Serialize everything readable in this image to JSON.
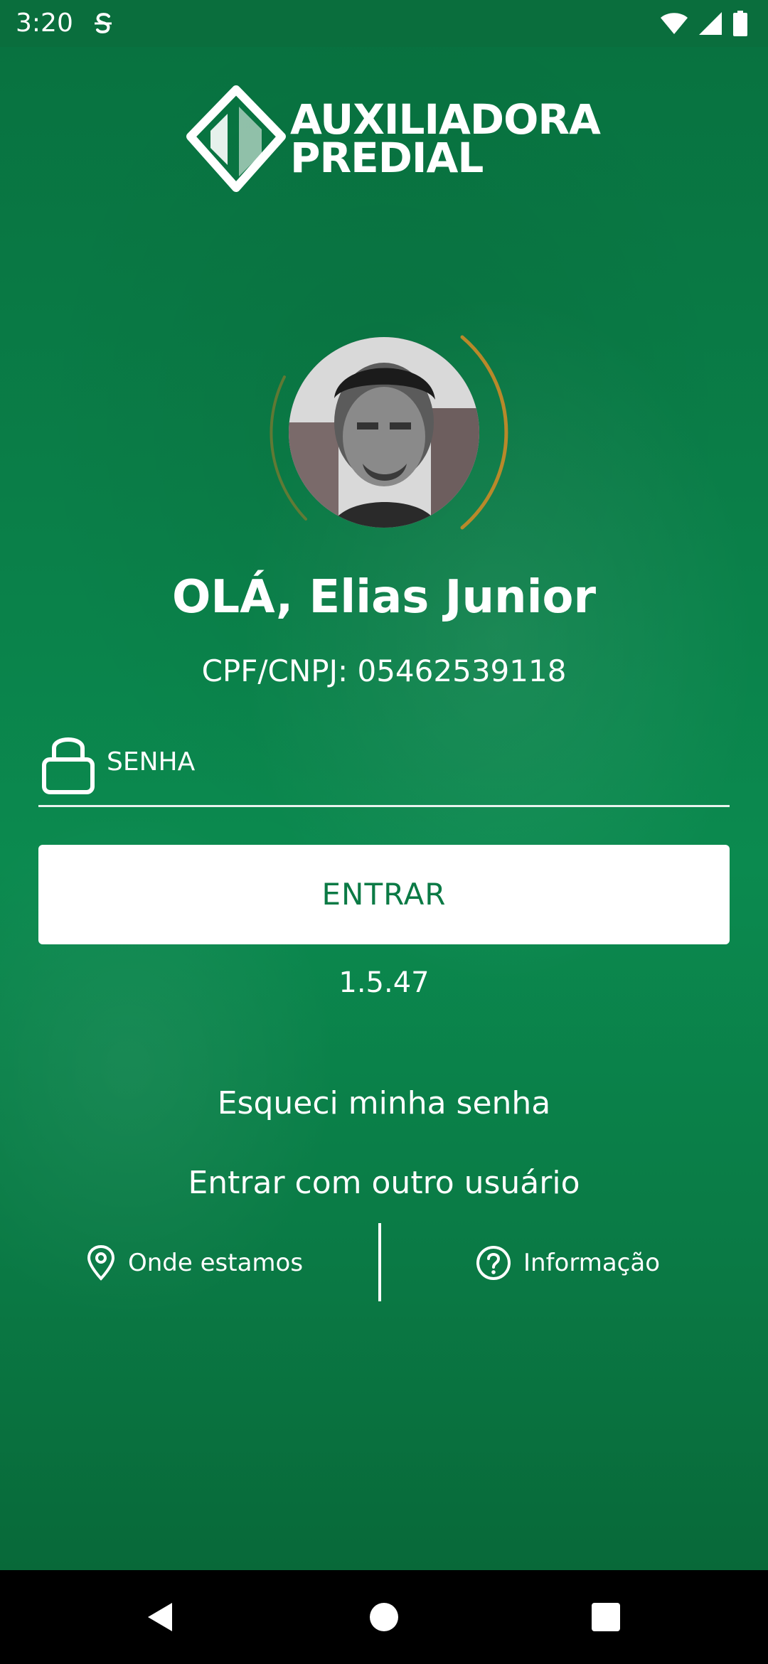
{
  "status_bar": {
    "time": "3:20"
  },
  "brand": {
    "line1": "AUXILIADORA",
    "line2": "PREDIAL"
  },
  "profile": {
    "greeting": "OLÁ, Elias Junior",
    "cpf": "CPF/CNPJ: 05462539118"
  },
  "login": {
    "password_placeholder": "SENHA",
    "password_value": "",
    "enter_label": "ENTRAR",
    "version": "1.5.47"
  },
  "links": {
    "forgot_password": "Esqueci minha senha",
    "other_user": "Entrar com outro usuário"
  },
  "footer": {
    "where": "Onde estamos",
    "info": "Informação"
  },
  "colors": {
    "brand_green": "#0b7a45",
    "status_bar": "#0a6e3d",
    "ring_accent": "#b8892a",
    "button_bg": "#ffffff"
  },
  "icons": {
    "status": [
      "s-notification-icon",
      "wifi-icon",
      "signal-icon",
      "battery-icon"
    ],
    "field": "lock-icon",
    "footer": [
      "location-pin-icon",
      "help-circle-icon"
    ],
    "nav": [
      "back-icon",
      "home-icon",
      "recents-icon"
    ]
  }
}
